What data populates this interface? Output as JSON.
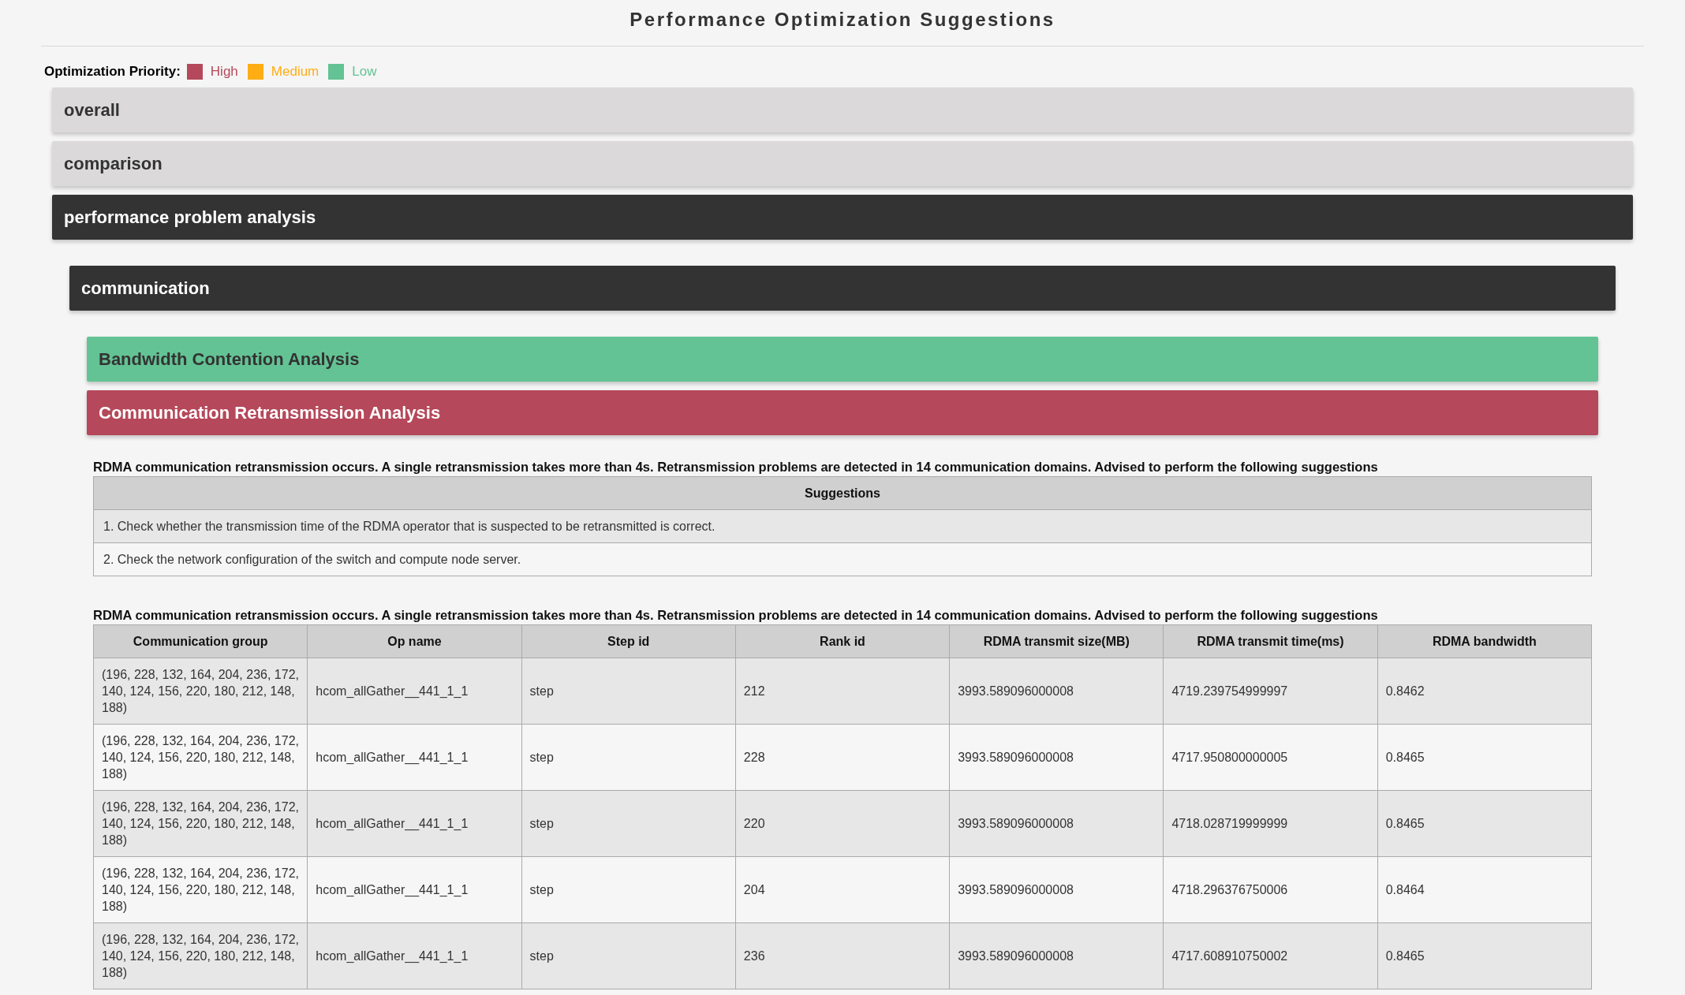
{
  "title": "Performance Optimization Suggestions",
  "legend": {
    "label": "Optimization Priority:",
    "items": [
      {
        "label": "High",
        "color": "#b5485a"
      },
      {
        "label": "Medium",
        "color": "#ffad14"
      },
      {
        "label": "Low",
        "color": "#63c394"
      }
    ]
  },
  "sections": [
    {
      "title": "overall",
      "expanded": false
    },
    {
      "title": "comparison",
      "expanded": false
    },
    {
      "title": "performance problem analysis",
      "expanded": true,
      "children": [
        {
          "title": "communication",
          "expanded": true,
          "children": [
            {
              "title": "Bandwidth Contention Analysis",
              "color": "#63c394",
              "expanded": false
            },
            {
              "title": "Communication Retransmission Analysis",
              "color": "#b5485a",
              "expanded": true,
              "blocks": [
                {
                  "description": "RDMA communication retransmission occurs. A single retransmission takes more than 4s. Retransmission problems are detected in 14 communication domains. Advised to perform the following suggestions",
                  "columns": [
                    "Suggestions"
                  ],
                  "rows": [
                    [
                      "1. Check whether the transmission time of the RDMA operator that is suspected to be retransmitted is correct."
                    ],
                    [
                      "2. Check the network configuration of the switch and compute node server."
                    ]
                  ]
                },
                {
                  "description": "RDMA communication retransmission occurs. A single retransmission takes more than 4s. Retransmission problems are detected in 14 communication domains. Advised to perform the following suggestions",
                  "columns": [
                    "Communication group",
                    "Op name",
                    "Step id",
                    "Rank id",
                    "RDMA transmit size(MB)",
                    "RDMA transmit time(ms)",
                    "RDMA bandwidth"
                  ],
                  "rows": [
                    [
                      "(196, 228, 132, 164, 204, 236, 172, 140, 124, 156, 220, 180, 212, 148, 188)",
                      "hcom_allGather__441_1_1",
                      "step",
                      "212",
                      "3993.589096000008",
                      "4719.239754999997",
                      "0.8462"
                    ],
                    [
                      "(196, 228, 132, 164, 204, 236, 172, 140, 124, 156, 220, 180, 212, 148, 188)",
                      "hcom_allGather__441_1_1",
                      "step",
                      "228",
                      "3993.589096000008",
                      "4717.950800000005",
                      "0.8465"
                    ],
                    [
                      "(196, 228, 132, 164, 204, 236, 172, 140, 124, 156, 220, 180, 212, 148, 188)",
                      "hcom_allGather__441_1_1",
                      "step",
                      "220",
                      "3993.589096000008",
                      "4718.028719999999",
                      "0.8465"
                    ],
                    [
                      "(196, 228, 132, 164, 204, 236, 172, 140, 124, 156, 220, 180, 212, 148, 188)",
                      "hcom_allGather__441_1_1",
                      "step",
                      "204",
                      "3993.589096000008",
                      "4718.296376750006",
                      "0.8464"
                    ],
                    [
                      "(196, 228, 132, 164, 204, 236, 172, 140, 124, 156, 220, 180, 212, 148, 188)",
                      "hcom_allGather__441_1_1",
                      "step",
                      "236",
                      "3993.589096000008",
                      "4717.608910750002",
                      "0.8465"
                    ]
                  ]
                }
              ]
            }
          ]
        }
      ]
    }
  ]
}
